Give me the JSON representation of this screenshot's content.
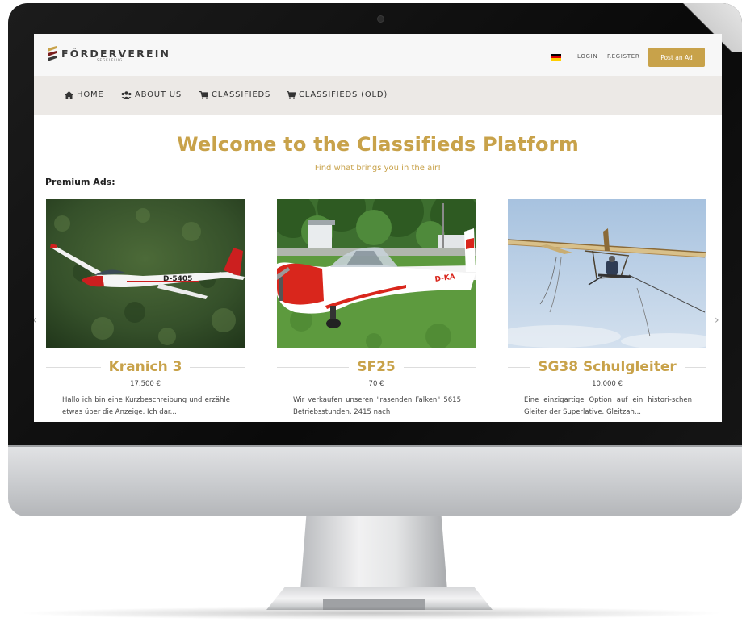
{
  "brand": {
    "name": "FÖRDERVEREIN",
    "sub": "SEGELFLUG",
    "colors": {
      "gold": "#c8a24a",
      "dark": "#3a3a3a"
    }
  },
  "topbar": {
    "language_flag": "de-flag-icon",
    "login": "LOGIN",
    "register": "REGISTER",
    "post_ad": "Post an Ad"
  },
  "nav": {
    "items": [
      {
        "icon": "home-icon",
        "label": "HOME"
      },
      {
        "icon": "users-icon",
        "label": "ABOUT US"
      },
      {
        "icon": "cart-icon",
        "label": "CLASSIFIEDS"
      },
      {
        "icon": "cart-icon",
        "label": "CLASSIFIEDS (OLD)"
      }
    ]
  },
  "hero": {
    "title": "Welcome to the Classifieds Platform",
    "tagline": "Find what brings you in the air!"
  },
  "premium": {
    "label": "Premium Ads:",
    "cards": [
      {
        "title": "Kranich 3",
        "price": "17.500 €",
        "registration": "D-5405",
        "description": "Hallo ich bin eine Kurzbeschreibung und erzähle etwas über die Anzeige. Ich dar..."
      },
      {
        "title": "SF25",
        "price": "70 €",
        "registration": "D-KA",
        "description": "Wir verkaufen unseren \"rasenden Falken\" 5615 Betriebsstunden. 2415 nach"
      },
      {
        "title": "SG38 Schulgleiter",
        "price": "10.000 €",
        "description": "Eine einzigartige Option auf ein histori-schen Gleiter der Superlative. Gleitzah..."
      }
    ]
  }
}
